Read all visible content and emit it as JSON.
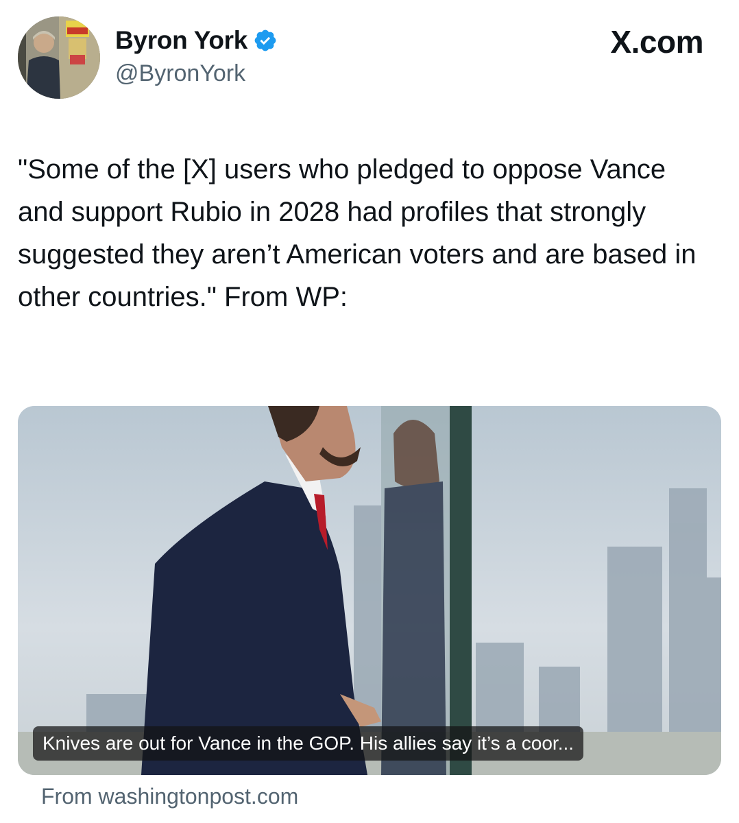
{
  "author": {
    "name": "Byron York",
    "handle": "@ByronYork",
    "verified": true,
    "verified_color": "#1d9bf0",
    "avatar_icon": "profile-photo"
  },
  "source_logo": "X.com",
  "tweet": {
    "text": "\"Some of the [X] users who pledged to oppose Vance and support Rubio in 2028 had profiles that strongly suggested they aren’t American voters and are based in other countries.\" From WP:"
  },
  "card": {
    "headline": "Knives are out for Vance in the GOP. His allies say it’s a coor...",
    "source": "From washingtonpost.com",
    "image_icon": "photo-man-in-suit-by-glass-pane"
  },
  "colors": {
    "text": "#0f1419",
    "secondary": "#536471",
    "accent": "#1d9bf0"
  }
}
